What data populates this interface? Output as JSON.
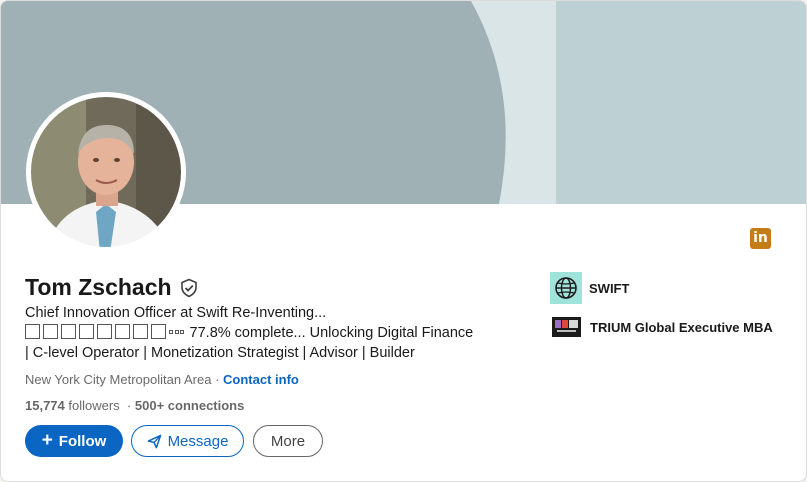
{
  "profile": {
    "name": "Tom Zschach",
    "headline_line1": "Chief Innovation Officer at Swift Re-Inventing...",
    "headline_line2_text": "77.8% complete... Unlocking Digital Finance",
    "headline_line3": "| C-level Operator | Monetization Strategist | Advisor | Builder",
    "location": "New York City Metropolitan Area",
    "location_separator": "·",
    "contact_link": "Contact info",
    "followers": "15,774",
    "followers_label": "followers",
    "connections_prefix": "·",
    "connections": "500+ connections"
  },
  "actions": {
    "follow_label": "Follow",
    "follow_plus": "+",
    "message_label": "Message",
    "more_label": "More"
  },
  "organizations": [
    {
      "name": "SWIFT",
      "logo_icon": "globe-icon"
    },
    {
      "name": "TRIUM Global Executive MBA",
      "logo_icon": "trium-logo"
    }
  ],
  "badge": {
    "text": "in",
    "color": "#c37d16"
  },
  "colors": {
    "accent": "#0a66c2",
    "banner_main": "#9fb1b4",
    "banner_light": "#dae5e7",
    "banner_right": "#bdd0d3"
  }
}
